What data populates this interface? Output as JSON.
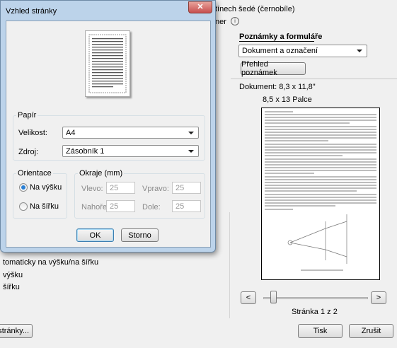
{
  "background": {
    "grayscale_text": "tínech šedé (černobíle)",
    "grayscale_text2": "ner",
    "annotations_title": "Poznámky a formuláře",
    "annotations_value": "Dokument a označení",
    "summary_button": "Přehled poznámek",
    "document_size": "Dokument: 8,3 x 11,8\"",
    "paper_size": "8,5 x 13 Palce",
    "auto_orient": "tomaticky na výšku/na šířku",
    "portrait": "výšku",
    "landscape": "šířku",
    "page_setup_button": "stránky...",
    "page_info": "Stránka 1 z 2",
    "print_button": "Tisk",
    "cancel_button": "Zrušit",
    "prev": "<",
    "next": ">"
  },
  "dialog": {
    "title": "Vzhled stránky",
    "paper_group": "Papír",
    "size_label": "Velikost:",
    "size_value": "A4",
    "source_label": "Zdroj:",
    "source_value": "Zásobník 1",
    "orientation_group": "Orientace",
    "portrait": "Na výšku",
    "landscape": "Na šířku",
    "orientation_selected": "portrait",
    "margins_group": "Okraje (mm)",
    "left_label": "Vlevo:",
    "left_value": "25",
    "right_label": "Vpravo:",
    "right_value": "25",
    "top_label": "Nahoře:",
    "top_value": "25",
    "bottom_label": "Dole:",
    "bottom_value": "25",
    "ok": "OK",
    "cancel": "Storno"
  },
  "colors": {
    "accent": "#3c7fb1",
    "titlebar": "#bcd3ea",
    "close": "#c75050"
  }
}
